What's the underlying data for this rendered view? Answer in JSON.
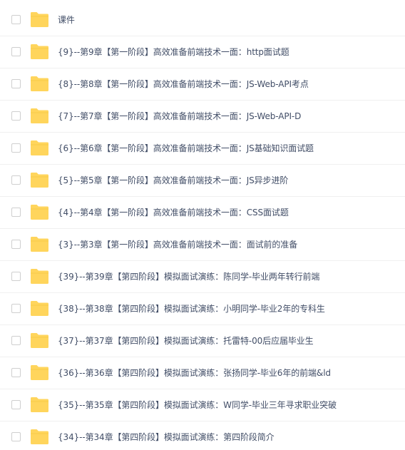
{
  "folder_color": "#ffd55c",
  "items": [
    {
      "name": "课件"
    },
    {
      "name": "{9}--第9章【第一阶段】高效准备前端技术一面：http面试题"
    },
    {
      "name": "{8}--第8章【第一阶段】高效准备前端技术一面：JS-Web-API考点"
    },
    {
      "name": "{7}--第7章【第一阶段】高效准备前端技术一面：JS-Web-API-D"
    },
    {
      "name": "{6}--第6章【第一阶段】高效准备前端技术一面：JS基础知识面试题"
    },
    {
      "name": "{5}--第5章【第一阶段】高效准备前端技术一面：JS异步进阶"
    },
    {
      "name": "{4}--第4章【第一阶段】高效准备前端技术一面：CSS面试题"
    },
    {
      "name": "{3}--第3章【第一阶段】高效准备前端技术一面：面试前的准备"
    },
    {
      "name": "{39}--第39章【第四阶段】模拟面试演练：陈同学-毕业两年转行前端"
    },
    {
      "name": "{38}--第38章【第四阶段】模拟面试演练：小明同学-毕业2年的专科生"
    },
    {
      "name": "{37}--第37章【第四阶段】模拟面试演练：托雷特-00后应届毕业生"
    },
    {
      "name": "{36}--第36章【第四阶段】模拟面试演练：张扬同学-毕业6年的前端&ld"
    },
    {
      "name": "{35}--第35章【第四阶段】模拟面试演练：W同学-毕业三年寻求职业突破"
    },
    {
      "name": "{34}--第34章【第四阶段】模拟面试演练：第四阶段简介"
    }
  ]
}
